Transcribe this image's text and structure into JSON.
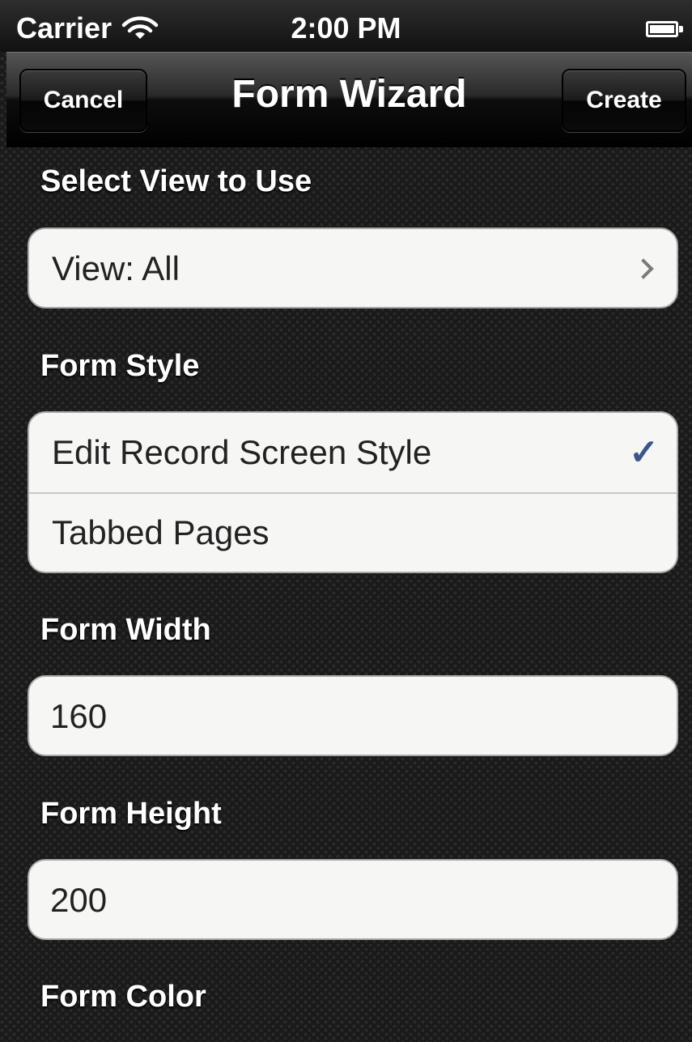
{
  "status_bar": {
    "carrier": "Carrier",
    "time": "2:00 PM"
  },
  "nav": {
    "title": "Form Wizard",
    "cancel_label": "Cancel",
    "create_label": "Create"
  },
  "sections": {
    "view": {
      "label": "Select View to Use",
      "value": "View: All"
    },
    "style": {
      "label": "Form Style",
      "options": [
        "Edit Record Screen Style",
        "Tabbed Pages"
      ],
      "selected": "Edit Record Screen Style",
      "checkmark": "✓"
    },
    "width": {
      "label": "Form Width",
      "value": "160"
    },
    "height": {
      "label": "Form Height",
      "value": "200"
    },
    "color": {
      "label": "Form Color"
    }
  },
  "icons": {
    "wifi": "wifi-icon",
    "battery": "battery-icon",
    "chevron": "chevron-right-icon",
    "check": "checkmark-icon"
  },
  "colors": {
    "checkmark": "#3a568a",
    "cell_background": "#f6f6f4"
  }
}
